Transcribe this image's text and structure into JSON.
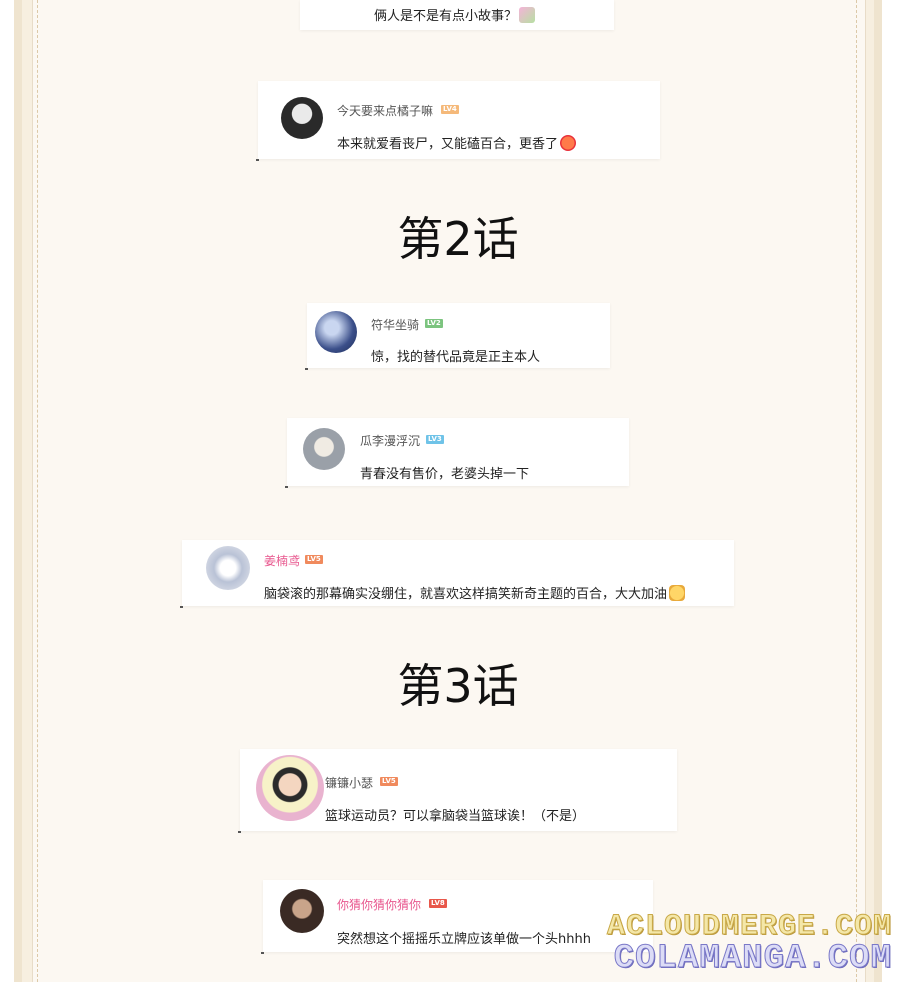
{
  "comments": [
    {
      "user": "",
      "level": "",
      "text": "俩人是不是有点小故事？",
      "emoji": "gift-emoji"
    },
    {
      "user": "今天要来点橘子嘛",
      "level": "LV4",
      "text": "本来就爱看丧尸，又能磕百合，更香了",
      "emoji": "heart-face-emoji"
    },
    {
      "user": "符华坐骑",
      "level": "LV2",
      "text": "惊，找的替代品竟是正主本人"
    },
    {
      "user": "瓜李漫浮沉",
      "level": "LV3",
      "text": "青春没有售价，老婆头掉一下"
    },
    {
      "user": "姜楠鸢",
      "level": "LV5",
      "text": "脑袋滚的那幕确实没绷住，就喜欢这样搞笑新奇主题的百合，大大加油",
      "emoji": "cat-emoji"
    },
    {
      "user": "镰镰小瑟",
      "level": "LV5",
      "text": "篮球运动员？可以拿脑袋当篮球诶！（不是）"
    },
    {
      "user": "你猜你猜你猜你",
      "level": "LV8",
      "text": "突然想这个摇摇乐立牌应该单做一个头hhhh"
    }
  ],
  "chapters": [
    "第2话",
    "第3话"
  ],
  "watermark": {
    "line1": "ACLOUDMERGE.COM",
    "line2": "COLAMANGA.COM"
  },
  "colors": {
    "paper": "#fcf8f2",
    "frame": "#efe4cf",
    "pink_name": "#e8578e",
    "badge_orange": "#f08a5d",
    "badge_green": "#7cc47f",
    "badge_blue": "#6fc3e8",
    "badge_red": "#e8574a"
  }
}
